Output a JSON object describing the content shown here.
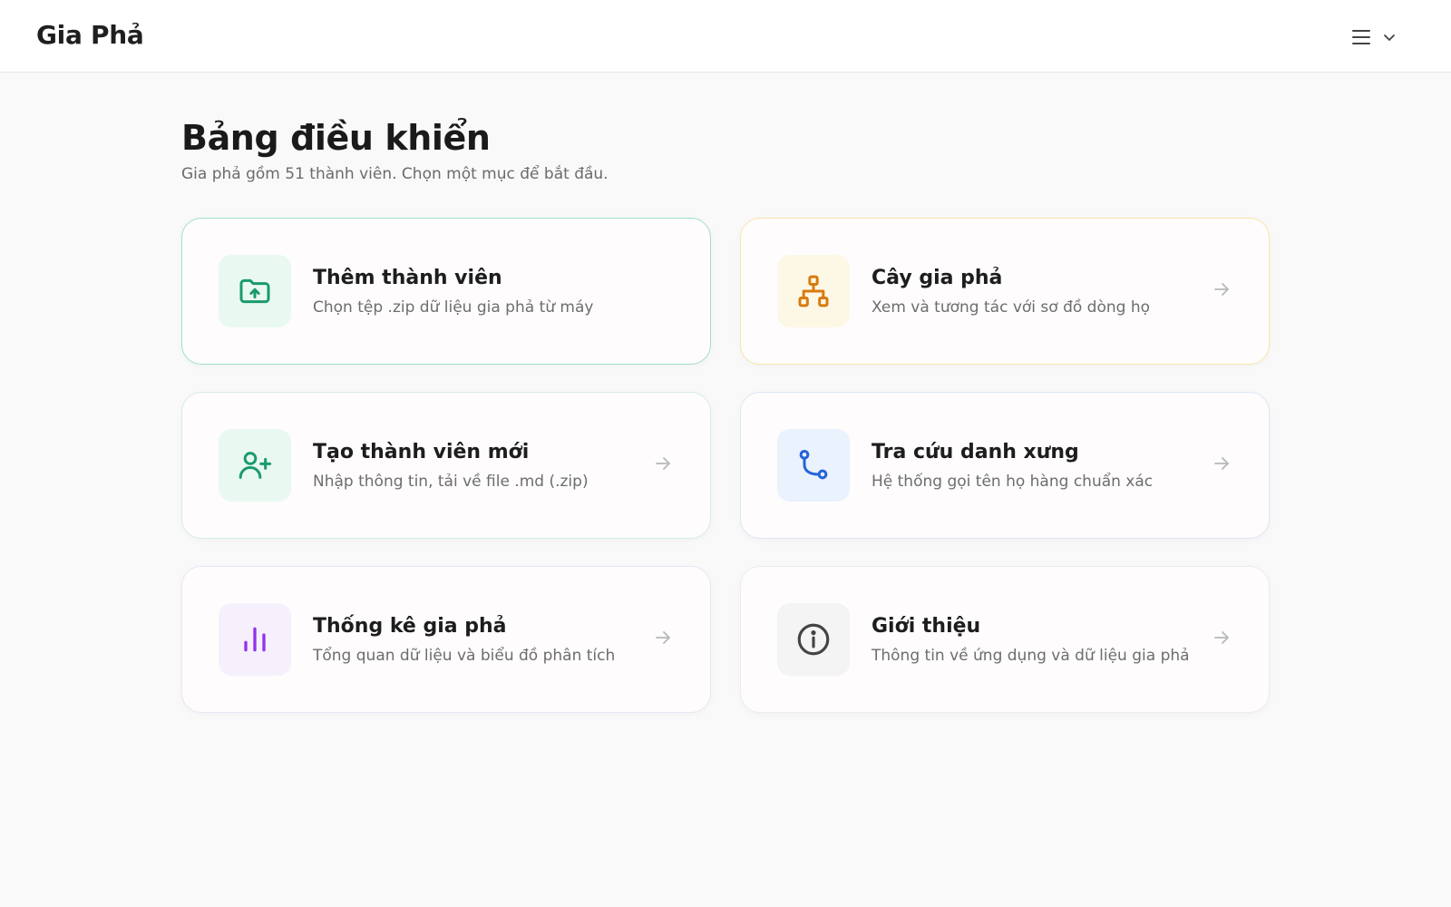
{
  "header": {
    "brand": "Gia Phả"
  },
  "dashboard": {
    "title": "Bảng điều khiển",
    "subtitle": "Gia phả gồm 51 thành viên. Chọn một mục để bắt đầu."
  },
  "cards": [
    {
      "title": "Thêm thành viên",
      "desc": "Chọn tệp .zip dữ liệu gia phả từ máy",
      "icon": "folder-upload-icon",
      "accent": "#1a9a6e",
      "bg": "#e9f9f2"
    },
    {
      "title": "Cây gia phả",
      "desc": "Xem và tương tác với sơ đồ dòng họ",
      "icon": "family-tree-icon",
      "accent": "#d97a0e",
      "bg": "#fdf8e6"
    },
    {
      "title": "Tạo thành viên mới",
      "desc": "Nhập thông tin, tải về file .md (.zip)",
      "icon": "user-plus-icon",
      "accent": "#1a9a6e",
      "bg": "#e9f9f2"
    },
    {
      "title": "Tra cứu danh xưng",
      "desc": "Hệ thống gọi tên họ hàng chuẩn xác",
      "icon": "route-icon",
      "accent": "#2563d9",
      "bg": "#eaf2fd"
    },
    {
      "title": "Thống kê gia phả",
      "desc": "Tổng quan dữ liệu và biểu đồ phân tích",
      "icon": "bar-chart-icon",
      "accent": "#9333ea",
      "bg": "#f6f0fd"
    },
    {
      "title": "Giới thiệu",
      "desc": "Thông tin về ứng dụng và dữ liệu gia phả",
      "icon": "info-icon",
      "accent": "#444444",
      "bg": "#f4f4f4"
    }
  ]
}
